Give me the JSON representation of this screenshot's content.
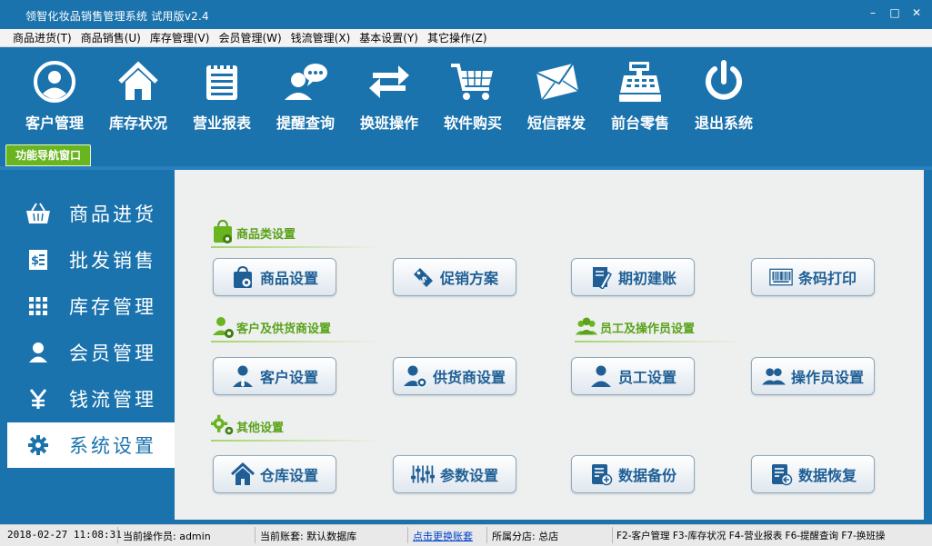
{
  "window": {
    "title": "领智化妆品销售管理系统 试用版v2.4",
    "controls": [
      "–",
      "□",
      "✕"
    ]
  },
  "menu": [
    "商品进货(T)",
    "商品销售(U)",
    "库存管理(V)",
    "会员管理(W)",
    "钱流管理(X)",
    "基本设置(Y)",
    "其它操作(Z)"
  ],
  "toolbar": [
    {
      "label": "客户管理",
      "icon": "user-circle-icon"
    },
    {
      "label": "库存状况",
      "icon": "house-icon"
    },
    {
      "label": "营业报表",
      "icon": "report-icon"
    },
    {
      "label": "提醒查询",
      "icon": "chat-user-icon"
    },
    {
      "label": "换班操作",
      "icon": "swap-icon"
    },
    {
      "label": "软件购买",
      "icon": "cart-icon"
    },
    {
      "label": "短信群发",
      "icon": "envelope-icon"
    },
    {
      "label": "前台零售",
      "icon": "cash-register-icon"
    },
    {
      "label": "退出系统",
      "icon": "power-icon"
    }
  ],
  "nav_tab": "功能导航窗口",
  "sidebar": [
    {
      "label": "商品进货",
      "icon": "basket-icon"
    },
    {
      "label": "批发销售",
      "icon": "invoice-icon"
    },
    {
      "label": "库存管理",
      "icon": "grid-icon"
    },
    {
      "label": "会员管理",
      "icon": "person-icon"
    },
    {
      "label": "钱流管理",
      "icon": "yen-icon"
    },
    {
      "label": "系统设置",
      "icon": "gear-icon",
      "active": true
    }
  ],
  "sections": {
    "goods": "商品类设置",
    "partners": "客户及供货商设置",
    "staff": "员工及操作员设置",
    "other": "其他设置"
  },
  "buttons": {
    "goods_setting": "商品设置",
    "promotion": "促销方案",
    "initial_account": "期初建账",
    "barcode_print": "条码打印",
    "customer_setting": "客户设置",
    "supplier_setting": "供货商设置",
    "employee_setting": "员工设置",
    "operator_setting": "操作员设置",
    "warehouse_setting": "仓库设置",
    "parameter_setting": "参数设置",
    "data_backup": "数据备份",
    "data_restore": "数据恢复"
  },
  "status": {
    "datetime": "2018-02-27 11:08:31",
    "operator": "当前操作员: admin",
    "account": "当前账套: 默认数据库",
    "switch_link": "点击更换账套",
    "branch": "所属分店: 总店",
    "hotkeys": "F2-客户管理 F3-库存状况 F4-营业报表 F6-提醒查询 F7-换班操"
  },
  "colors": {
    "primary": "#1b73ae",
    "accent_green": "#69b51f",
    "button_text": "#1f5f95",
    "panel_bg": "#eef0f0"
  }
}
